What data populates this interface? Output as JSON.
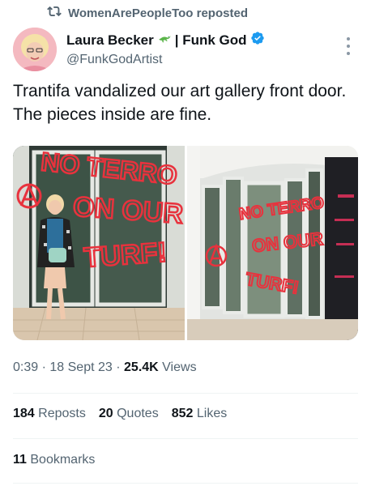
{
  "repost": {
    "text": "WomenArePeopleToo reposted",
    "icon": "repost-icon"
  },
  "author": {
    "name": "Laura Becker",
    "name_suffix": "| Funk God",
    "handle": "@FunkGodArtist",
    "verified": true,
    "avatar_icon": "avatar",
    "emoji_icon": "lizard-emoji-icon"
  },
  "tweet": {
    "text": "Trantifa vandalized our art gallery front door.  The pieces inside are fine."
  },
  "media": [
    {
      "graffiti": [
        "NO TERRO",
        "ON OUR",
        "TURF!"
      ]
    },
    {
      "graffiti": [
        "NO TERRO",
        "ON OUR",
        "TURF!"
      ]
    }
  ],
  "meta": {
    "time": "0:39",
    "sep1": "·",
    "date": "18 Sept 23",
    "sep2": "·",
    "views_count": "25.4K",
    "views_label": "Views"
  },
  "stats": {
    "reposts_count": "184",
    "reposts_label": "Reposts",
    "quotes_count": "20",
    "quotes_label": "Quotes",
    "likes_count": "852",
    "likes_label": "Likes"
  },
  "bookmarks": {
    "count": "11",
    "label": "Bookmarks"
  },
  "colors": {
    "accent": "#1d9bf0",
    "muted": "#536471",
    "graffiti": "#e8323d"
  }
}
